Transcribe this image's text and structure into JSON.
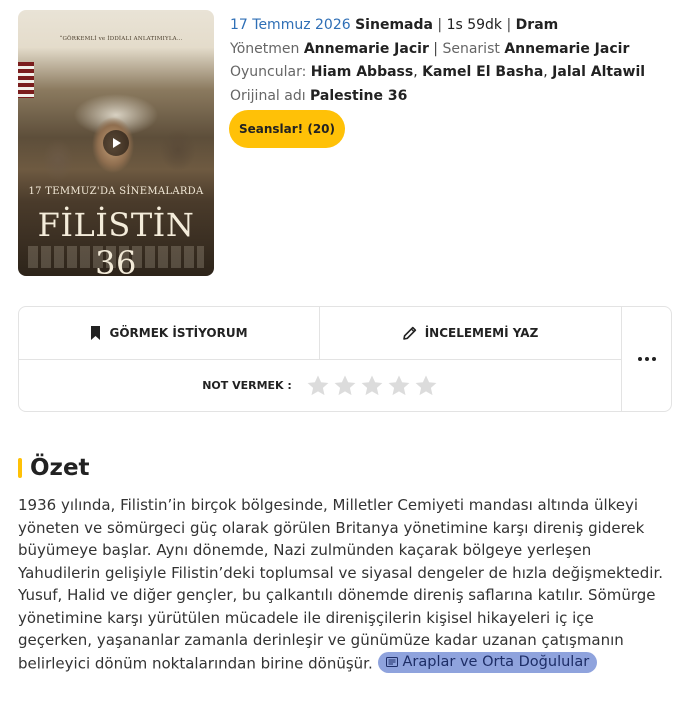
{
  "poster": {
    "quote": "“GÖRKEMLİ ve İDDİALI ANLATIMIYLA…",
    "release_line": "17 TEMMUZ'DA SİNEMALARDA",
    "title": "FİLİSTİN 36"
  },
  "info": {
    "date": "17 Temmuz 2026",
    "status": "Sinemada",
    "duration": "1s 59dk",
    "genre": "Dram",
    "director_label": "Yönetmen",
    "director": "Annemarie Jacir",
    "writer_label": "Senarist",
    "writer": "Annemarie Jacir",
    "cast_label": "Oyuncular:",
    "cast": [
      "Hiam Abbass",
      "Kamel El Basha",
      "Jalal Altawil"
    ],
    "original_label": "Orijinal adı",
    "original_title": "Palestine 36",
    "sessions_button": "Seanslar! (20)"
  },
  "actions": {
    "want_to_see": "GÖRMEK İSTİYORUM",
    "write_review": "İNCELEMEMİ YAZ",
    "rate_label": "NOT VERMEK :",
    "stars_total": 5,
    "stars_filled": 0
  },
  "summary": {
    "title": "Özet",
    "text": "1936 yılında, Filistin’in birçok bölgesinde, Milletler Cemiyeti mandası altında ülkeyi yöneten ve sömürgeci güç olarak görülen Britanya yönetimine karşı direniş giderek büyümeye başlar. Aynı dönemde, Nazi zulmünden kaçarak bölgeye yerleşen Yahudilerin gelişiyle Filistin’deki toplumsal ve siyasal dengeler de hızla değişmektedir. Yusuf, Halid ve diğer gençler, bu çalkantılı dönemde direniş saflarına katılır. Sömürge yönetimine karşı yürütülen mücadele ile direnişçilerin kişisel hikayeleri iç içe geçerken, yaşananlar zamanla derinleşir ve günümüze kadar uzanan çatışmanın belirleyici dönüm noktalarından birine dönüşür.",
    "tag": "Araplar ve Orta Doğulular"
  },
  "colors": {
    "accent": "#ffc107",
    "link_blue": "#2f6fb6",
    "tag_bg": "#8fa3dd"
  }
}
